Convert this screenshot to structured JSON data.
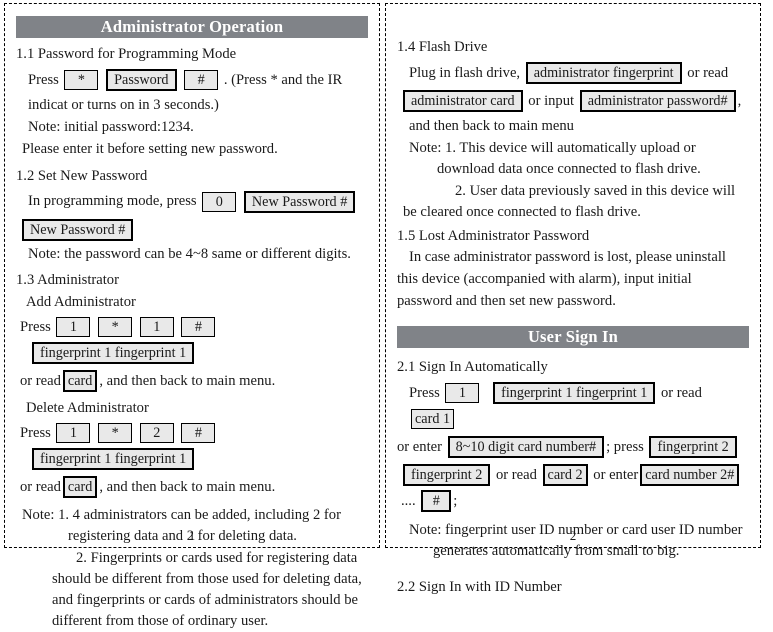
{
  "left_page": {
    "banner": "Administrator Operation",
    "page_number": "1",
    "sec_1_1": {
      "heading": "1.1 Password for Programming Mode",
      "press_label": "Press",
      "key_star": "*",
      "key_password": "Password",
      "key_hash": "#",
      "after_keys": ". (Press * and the IR",
      "line2": "indicat or turns on in 3 seconds.)",
      "line3": "Note: initial password:1234.",
      "line4": "Please enter it before setting new password."
    },
    "sec_1_2": {
      "heading": "1.2 Set New Password",
      "lead": "In programming mode, press",
      "key_zero": "0",
      "box_new_password_1": "New Password #",
      "box_new_password_2": "New Password #",
      "note": "Note: the password can be 4~8 same or different digits."
    },
    "sec_1_3": {
      "heading": "1.3 Administrator",
      "add_title": "Add Administrator",
      "press_label": "Press",
      "add_key_1": "1",
      "add_key_star": "*",
      "add_key_2": "1",
      "add_key_hash": "#",
      "add_box_fingerprint": "fingerprint 1 fingerprint 1",
      "or_read_prefix": "or read",
      "box_card": "card",
      "or_read_suffix": ", and then back to main menu.",
      "delete_title": "Delete Administrator",
      "del_key_1": "1",
      "del_key_star": "*",
      "del_key_2": "2",
      "del_key_hash": "#",
      "del_box_fingerprint": "fingerprint 1 fingerprint 1",
      "del_or_read_prefix": "or read",
      "del_box_card": "card",
      "del_or_read_suffix": ", and then back to main menu.",
      "note_1": "Note: 1. 4 administrators can be added, including 2 for registering data and 2 for deleting data.",
      "note_2": "2. Fingerprints or cards used for registering data should be different from those used for deleting data, and fingerprints or cards of administrators should be different from those of ordinary user."
    }
  },
  "right_page": {
    "page_number": "2",
    "sec_1_4": {
      "heading": "1.4 Flash Drive",
      "lead": "Plug in flash drive,",
      "box_admin_fingerprint": "administrator fingerprint",
      "or_read": "or read",
      "box_admin_card": "administrator card",
      "or_input": "or input",
      "box_admin_password": "administrator password#",
      "comma": ",",
      "line3": "and then back to main menu",
      "note_1": "Note: 1. This device will automatically upload or download data once connected to flash drive.",
      "note_2": "2. User data previously saved in this device will be cleared once connected to flash drive."
    },
    "sec_1_5": {
      "heading": "1.5 Lost Administrator Password",
      "line1": "In case administrator  password is lost, please uninstall",
      "line2": "this device (accompanied with alarm), input initial",
      "line3": "password and then set new password."
    },
    "banner": "User Sign In",
    "sec_2_1": {
      "heading": "2.1 Sign In Automatically",
      "press_label": "Press",
      "key_1": "1",
      "box_fingerprint_1": "fingerprint 1  fingerprint 1",
      "or_read": "or read",
      "box_card_1": "card 1",
      "or_enter": "or enter",
      "box_digit_card": "8~10 digit card number#",
      "semicolon_press": "; press",
      "box_fingerprint_2a": "fingerprint 2",
      "box_fingerprint_2b": "fingerprint 2",
      "or_read_2": "or read",
      "box_card_2": "card 2",
      "or_enter_2": "or enter",
      "box_card_number_2": "card number 2#",
      "ellipsis": "....",
      "box_hash": "#",
      "trailing": ";",
      "note": "Note: fingerprint user ID number or card user ID number generates automatically from small to big."
    },
    "sec_2_2": {
      "heading": "2.2 Sign In with ID Number"
    }
  }
}
